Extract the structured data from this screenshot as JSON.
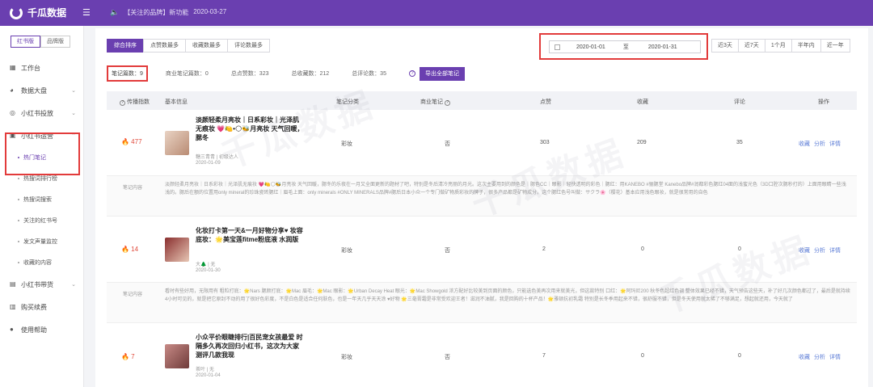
{
  "app": {
    "name": "千瓜数据",
    "menu_icon": "hamburger-icon"
  },
  "notice": {
    "icon": "speaker-icon",
    "text": "【关注的品牌】新功能",
    "date": "2020-03-27"
  },
  "sidebar": {
    "switch": [
      "红书版",
      "品牌版"
    ],
    "items": [
      {
        "label": "工作台",
        "icon": "grid-icon"
      },
      {
        "label": "数据大盘",
        "icon": "pie-icon",
        "chevron": "⌄"
      },
      {
        "label": "小红书投放",
        "icon": "target-icon",
        "chevron": "⌄"
      },
      {
        "label": "小红书运营",
        "icon": "chat-icon",
        "chevron": "⌃"
      }
    ],
    "sub_items": [
      {
        "label": "热门笔记"
      },
      {
        "label": "热搜词排行榜"
      },
      {
        "label": "热搜词搜索"
      },
      {
        "label": "关注的红书号"
      },
      {
        "label": "发文声量监控"
      },
      {
        "label": "收藏的内容"
      }
    ],
    "bottom_items": [
      {
        "label": "小红书带货",
        "icon": "cart-icon",
        "chevron": "⌄"
      },
      {
        "label": "购买续费",
        "icon": "wallet-icon"
      },
      {
        "label": "使用帮助",
        "icon": "help-icon"
      }
    ]
  },
  "tabs": [
    "综合排序",
    "点赞数最多",
    "收藏数最多",
    "评论数最多"
  ],
  "date_range": {
    "start": "2020-01-01",
    "sep": "至",
    "end": "2020-01-31"
  },
  "quick_ranges": [
    "近3天",
    "近7天",
    "1个月",
    "半年内",
    "近一年"
  ],
  "stats": {
    "notes": "笔记篇数：9",
    "commercial": "商业笔记篇数：0",
    "likes": "总点赞数：323",
    "favs": "总收藏数：212",
    "comments": "总评论数：35",
    "export": "导出全部笔记"
  },
  "table": {
    "headers": [
      "传播指数",
      "基本信息",
      "笔记分类",
      "商业笔记",
      "点赞",
      "收藏",
      "评论",
      "操作"
    ],
    "op_labels": [
      "收藏",
      "分析",
      "详情"
    ],
    "content_label": "笔记内容",
    "rows": [
      {
        "index": "🔥 477",
        "title": "淡颜轻柔月亮妆｜日系彩妆｜光泽肌无痕妆 💗🍋•🌕🐝月亮妆 天气回暖，腮冬",
        "author": "糖三青青 | 初级达人",
        "date": "2020-01-09",
        "category": "彩妆",
        "commercial": "否",
        "likes": "303",
        "favs": "209",
        "comments": "35",
        "content": "淡颜轻柔月亮妆｜日系彩妆｜光泽肌无痕妆 💗🍋🌕🐝月亮妆 天气回暖，腮冬的乐夜在一月又全面更新的题材了吧，特别是冬后清冷亮丽的月光。这次主要用到的颜色是｜腮色CC｜眼影｜轻快透明的彩色｜腮红：用KANEBO #骊腮堂 Kanebo品牌#润都彩色腮红04面的浅蜜光色（3D口腔次腮秒打的）上面用眼睛一些浅浅的。腮后在额的位置用only mineral的珍珠瓷砖腮红｜眉毛上面：only minerals #ONLY MINERALS品牌#腮后日本小众一个专门做矿物质彩妆的牌子，很多产品都是矿物成分。这个腮红色号叫做：サクラ🌸（樱花）基本应用浅色眼妆，就是很常用的自色"
      },
      {
        "index": "🔥 14",
        "title": "化妆打卡第一天&一月好物分享♥ 妆容 底妆：🌟美宝莲fitme粉底液 水润版",
        "author": "大🌲 | 无",
        "date": "2020-01-30",
        "category": "彩妆",
        "commercial": "否",
        "likes": "2",
        "favs": "0",
        "comments": "0",
        "content": "看时有些好用，无限用有 粗粒打底：🌟Nars 腮颜打底：🌟Mac 眉毛：🌟Mac 眼影：🌟Urban Decay Heat 眼光：🌟Mac Showgold 浓方配好比较美到页面的颜色，只能选色美再次用来就美光，但这款特别 口红：🌟阿玛尼200 秋冬色超红色调 整体效果已经不错，天气预告这些天，补了好几次颜色都过了，最后是就持续4小时可见的，就是把它原封不动的用了很好色彩度，不是白色是适合任何肤色，也是一年天几乎天天涂 ♥好物 🌟三毫膏霜是非常受欢迎王者！滋润不油腻，我是回购的十杯产品！🌟雅顿抗初乳霜 特别是长冬季用起来不错，很舒服不错，但是冬天使用就太稀了不够满足，想起就还用，今天就了"
      },
      {
        "index": "🔥 7",
        "title": "小众平价眼睫排行|百民宠女孩最爱 时隔多久再次回归小红书，这次为大家测评几款我现",
        "author": "茶叶 | 无",
        "date": "2020-01-04",
        "category": "彩妆",
        "commercial": "否",
        "likes": "7",
        "favs": "0",
        "comments": "0"
      }
    ]
  },
  "watermark": "千瓜数据",
  "colors": {
    "brand": "#6a3fb0",
    "highlight": "#e23b3b",
    "link": "#5a7bd6"
  }
}
